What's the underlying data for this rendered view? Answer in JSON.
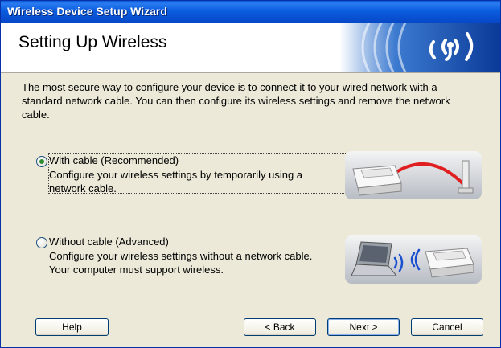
{
  "window": {
    "title": "Wireless Device Setup Wizard"
  },
  "header": {
    "title": "Setting Up Wireless"
  },
  "intro": "The most secure way to configure your device is to connect it to your wired network with a standard network cable. You can then configure its wireless settings and remove the network cable.",
  "options": [
    {
      "label": "With cable (Recommended)",
      "description": "Configure your wireless settings by temporarily using a network cable.",
      "selected": true
    },
    {
      "label": "Without cable (Advanced)",
      "description": "Configure your wireless settings without a network cable. Your computer must support wireless.",
      "selected": false
    }
  ],
  "buttons": {
    "help": "Help",
    "back": "< Back",
    "next": "Next >",
    "cancel": "Cancel"
  },
  "colors": {
    "titlebar": "#0a5ad8",
    "dialog_bg": "#ece9d8",
    "banner": "#0b4eb0",
    "cable": "#e02020",
    "radio_dot": "#2e8b2e"
  }
}
